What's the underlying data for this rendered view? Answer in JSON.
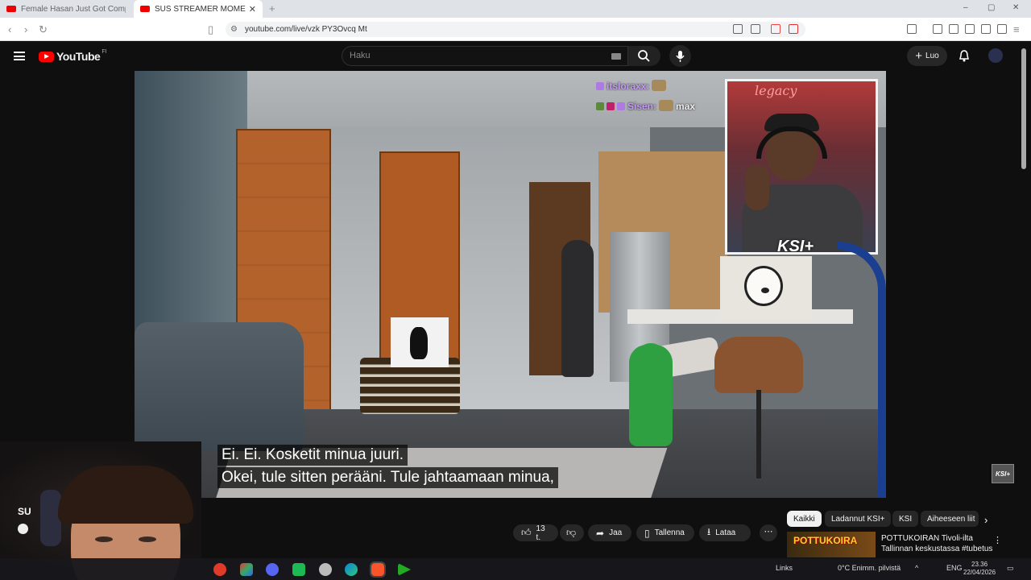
{
  "browser": {
    "tabs": [
      {
        "title": "Female Hasan Just Got Completely [",
        "active": false
      },
      {
        "title": "SUS STREAMER MOMENTS -",
        "active": true
      }
    ],
    "new_tab": "+",
    "url": "youtube.com/live/vzk PY3Ovcq Mt",
    "window_controls": [
      "–",
      "▢",
      "✕"
    ]
  },
  "youtube": {
    "logo_text": "YouTube",
    "country_code": "FI",
    "search_placeholder": "Haku",
    "create_label": "Luo"
  },
  "video": {
    "chat": [
      {
        "user": "itsloraxx",
        "message": ""
      },
      {
        "user": "Sisen",
        "message": "max"
      }
    ],
    "webcam_neon": "legacy",
    "webcam_logo": "KSI+",
    "subtitles": [
      "Ei. Ei. Kosketit minua juuri.",
      "Okei, tule sitten perääni.  Tule jahtaamaan minua,"
    ],
    "corner_badge": "KSI+"
  },
  "below_video": {
    "channel_initials": "SU",
    "likes": "13 t.",
    "share_label": "Jaa",
    "save_label": "Tallenna",
    "download_label": "Lataa",
    "more_label": "⋯"
  },
  "chips": [
    "Kaikki",
    "Ladannut KSI+",
    "KSI",
    "Aiheeseen liit"
  ],
  "recommendation": {
    "thumb_text": "POTTUKOIRA",
    "title": "POTTUKOIRAN Tivoli-ilta Tallinnan keskustassa #tubetus"
  },
  "taskbar": {
    "links_label": "Links",
    "weather": "0°C  Enimm. pilvistä",
    "language": "ENG",
    "time": "23.36",
    "date": "22/04/2026"
  },
  "colors": {
    "youtube_red": "#ff0000",
    "chat_username": "#c79bf5",
    "dark_bg": "#0f0f0f"
  }
}
